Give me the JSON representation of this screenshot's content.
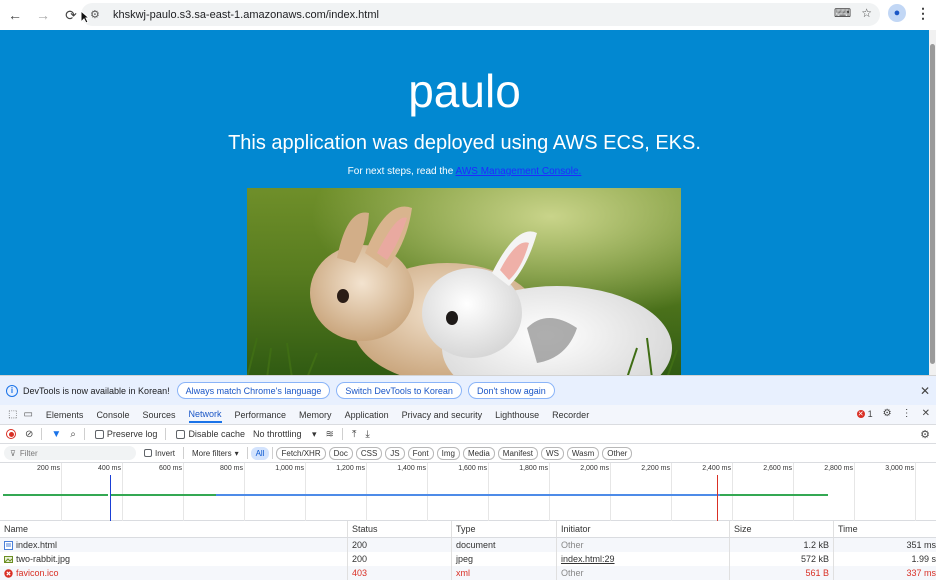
{
  "browser": {
    "url": "khskwj-paulo.s3.sa-east-1.amazonaws.com/index.html"
  },
  "page": {
    "title": "paulo",
    "subtitle": "This application was deployed using AWS ECS, EKS.",
    "next_steps_prefix": "For next steps, read the ",
    "next_steps_link": "AWS Management Console.",
    "background_color": "#0288d1"
  },
  "devtools": {
    "infobar": {
      "message": "DevTools is now available in Korean!",
      "btn_match": "Always match Chrome's language",
      "btn_switch": "Switch DevTools to Korean",
      "btn_dont_show": "Don't show again"
    },
    "tabs": [
      "Elements",
      "Console",
      "Sources",
      "Network",
      "Performance",
      "Memory",
      "Application",
      "Privacy and security",
      "Lighthouse",
      "Recorder"
    ],
    "active_tab": "Network",
    "error_count": "1",
    "controls": {
      "preserve_log": "Preserve log",
      "disable_cache": "Disable cache",
      "throttling": "No throttling"
    },
    "filter": {
      "placeholder": "Filter",
      "invert": "Invert",
      "more_filters": "More filters",
      "chips": [
        "All",
        "Fetch/XHR",
        "Doc",
        "CSS",
        "JS",
        "Font",
        "Img",
        "Media",
        "Manifest",
        "WS",
        "Wasm",
        "Other"
      ]
    },
    "timeline_ticks": [
      "200 ms",
      "400 ms",
      "600 ms",
      "800 ms",
      "1,000 ms",
      "1,200 ms",
      "1,400 ms",
      "1,600 ms",
      "1,800 ms",
      "2,000 ms",
      "2,200 ms",
      "2,400 ms",
      "2,600 ms",
      "2,800 ms",
      "3,000 ms"
    ],
    "table": {
      "headers": [
        "Name",
        "Status",
        "Type",
        "Initiator",
        "Size",
        "Time"
      ],
      "rows": [
        {
          "name": "index.html",
          "status": "200",
          "type": "document",
          "initiator": "Other",
          "size": "1.2 kB",
          "time": "351 ms",
          "error": false
        },
        {
          "name": "two-rabbit.jpg",
          "status": "200",
          "type": "jpeg",
          "initiator": "index.html:29",
          "size": "572 kB",
          "time": "1.99 s",
          "error": false
        },
        {
          "name": "favicon.ico",
          "status": "403",
          "type": "xml",
          "initiator": "Other",
          "size": "561 B",
          "time": "337 ms",
          "error": true
        }
      ]
    }
  }
}
